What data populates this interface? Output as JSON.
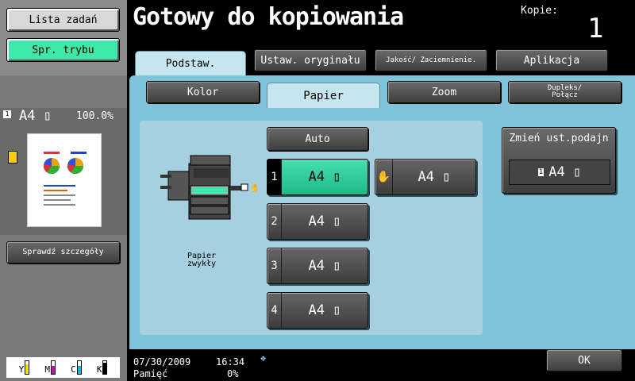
{
  "sidebar": {
    "job_list_label": "Lista zadań",
    "mode_check_label": "Spr. trybu",
    "preview_paper": "A4",
    "preview_zoom": "100.0%",
    "check_details_label": "Sprawdź szczegóły",
    "toners": [
      {
        "letter": "Y",
        "color": "#e8e800",
        "level": 0.75
      },
      {
        "letter": "M",
        "color": "#d000c0",
        "level": 0.65
      },
      {
        "letter": "C",
        "color": "#00b8e0",
        "level": 0.6
      },
      {
        "letter": "K",
        "color": "#000000",
        "level": 0.85
      }
    ]
  },
  "header": {
    "title": "Gotowy do kopiowania",
    "copies_label": "Kopie:",
    "copies_value": "1"
  },
  "main_tabs": [
    {
      "label": "Podstaw.",
      "active": true
    },
    {
      "label": "Ustaw. oryginału",
      "active": false
    },
    {
      "label": "Jakość/ Zaciemnienie.",
      "active": false
    },
    {
      "label": "Aplikacja",
      "active": false
    }
  ],
  "sub_tabs": [
    {
      "label": "Kolor",
      "active": false
    },
    {
      "label": "Papier",
      "active": true
    },
    {
      "label": "Zoom",
      "active": false
    },
    {
      "label": "Dupleks/ Połącz",
      "active": false
    }
  ],
  "paper": {
    "machine_label": "Papier zwykły",
    "auto_label": "Auto",
    "trays": [
      {
        "num": "1",
        "size": "A4",
        "selected": true
      },
      {
        "num": "2",
        "size": "A4",
        "selected": false
      },
      {
        "num": "3",
        "size": "A4",
        "selected": false
      },
      {
        "num": "4",
        "size": "A4",
        "selected": false
      }
    ],
    "bypass_size": "A4",
    "change_setting_label": "Zmień ust.podajn",
    "change_setting_tray_num": "1",
    "change_setting_value": "A4"
  },
  "ok_label": "OK",
  "status": {
    "date": "07/30/2009",
    "time": "16:34",
    "memory_label": "Pamięć",
    "memory_value": "0%"
  }
}
